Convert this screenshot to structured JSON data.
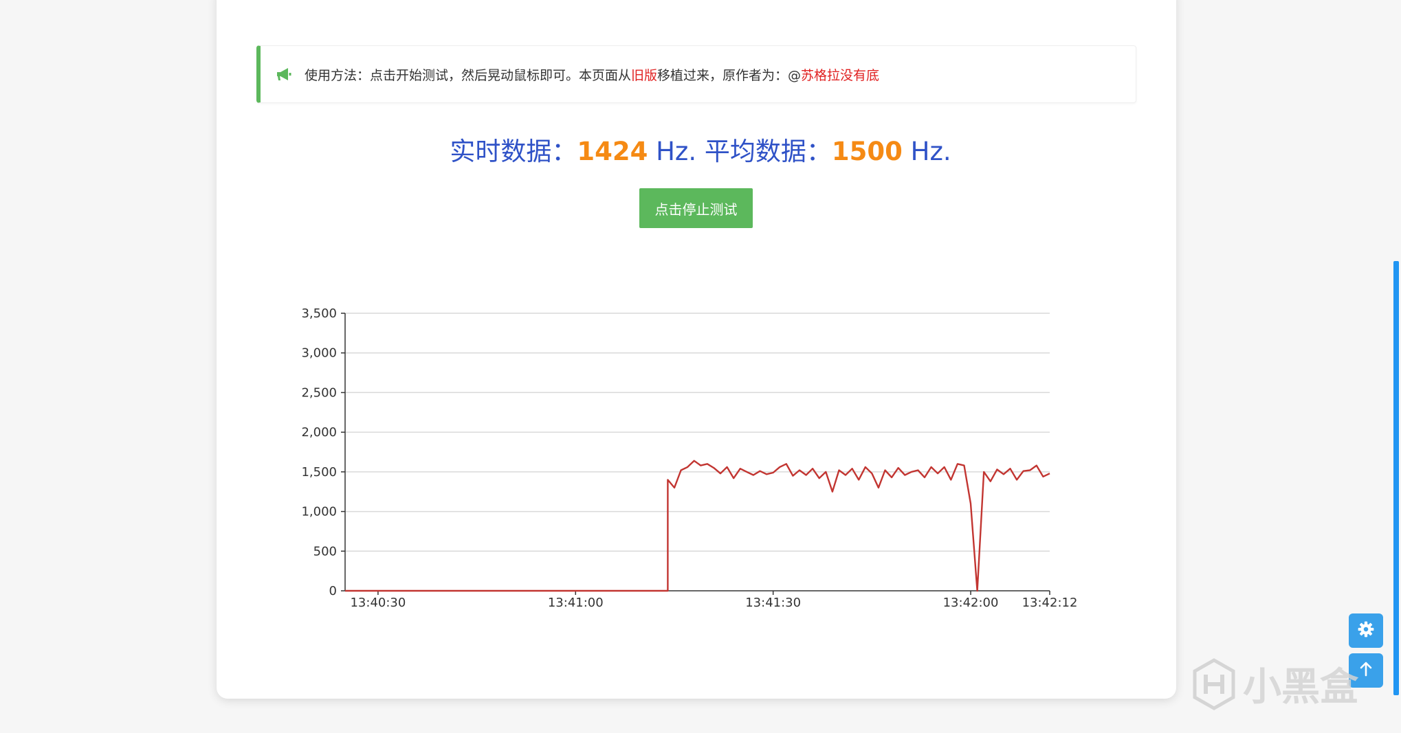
{
  "notice": {
    "prefix": "使用方法：点击开始测试，然后晃动鼠标即可。本页面从",
    "old_link": "旧版",
    "middle": "移植过来，原作者为：@",
    "author": "苏格拉没有底",
    "icon": "megaphone-icon",
    "accent_color": "#5cb85c"
  },
  "stats": {
    "realtime_label": "实时数据：",
    "realtime_value": "1424",
    "realtime_unit": " Hz. ",
    "avg_label": "平均数据：",
    "avg_value": "1500",
    "avg_unit": " Hz."
  },
  "button": {
    "label": "点击停止测试",
    "color": "#5cb85c"
  },
  "chart_data": {
    "type": "line",
    "title": "",
    "xlabel": "",
    "ylabel": "",
    "ylim": [
      0,
      3500
    ],
    "yticks": [
      0,
      500,
      1000,
      1500,
      2000,
      2500,
      3000,
      3500
    ],
    "ytick_labels": [
      "0",
      "500",
      "1,000",
      "1,500",
      "2,000",
      "2,500",
      "3,000",
      "3,500"
    ],
    "xlim_seconds_from": "13:40:25",
    "xticks": [
      "13:40:30",
      "13:41:00",
      "13:41:30",
      "13:42:00",
      "13:42:12"
    ],
    "grid": true,
    "series_color": "#c23531",
    "x": [
      "13:40:25",
      "13:41:14",
      "13:41:14",
      "13:41:15",
      "13:41:16",
      "13:41:17",
      "13:41:18",
      "13:41:19",
      "13:41:20",
      "13:41:21",
      "13:41:22",
      "13:41:23",
      "13:41:24",
      "13:41:25",
      "13:41:26",
      "13:41:27",
      "13:41:28",
      "13:41:29",
      "13:41:30",
      "13:41:31",
      "13:41:32",
      "13:41:33",
      "13:41:34",
      "13:41:35",
      "13:41:36",
      "13:41:37",
      "13:41:38",
      "13:41:39",
      "13:41:40",
      "13:41:41",
      "13:41:42",
      "13:41:43",
      "13:41:44",
      "13:41:45",
      "13:41:46",
      "13:41:47",
      "13:41:48",
      "13:41:49",
      "13:41:50",
      "13:41:51",
      "13:41:52",
      "13:41:53",
      "13:41:54",
      "13:41:55",
      "13:41:56",
      "13:41:57",
      "13:41:58",
      "13:41:59",
      "13:42:00",
      "13:42:01",
      "13:42:02",
      "13:42:03",
      "13:42:04",
      "13:42:05",
      "13:42:06",
      "13:42:07",
      "13:42:08",
      "13:42:09",
      "13:42:10",
      "13:42:11",
      "13:42:12"
    ],
    "values": [
      0,
      0,
      1400,
      1300,
      1520,
      1560,
      1640,
      1580,
      1600,
      1550,
      1480,
      1560,
      1420,
      1540,
      1500,
      1460,
      1510,
      1470,
      1490,
      1560,
      1600,
      1450,
      1520,
      1460,
      1540,
      1420,
      1500,
      1250,
      1520,
      1460,
      1540,
      1400,
      1560,
      1480,
      1300,
      1520,
      1430,
      1550,
      1460,
      1500,
      1520,
      1430,
      1560,
      1480,
      1560,
      1400,
      1600,
      1580,
      1100,
      0,
      1500,
      1380,
      1530,
      1470,
      1540,
      1400,
      1510,
      1520,
      1580,
      1440,
      1480
    ]
  },
  "side_buttons": {
    "settings_icon": "gear-icon",
    "top_icon": "arrow-up-icon",
    "color": "#3aa1ea"
  },
  "watermark": {
    "text": "小黑盒"
  }
}
